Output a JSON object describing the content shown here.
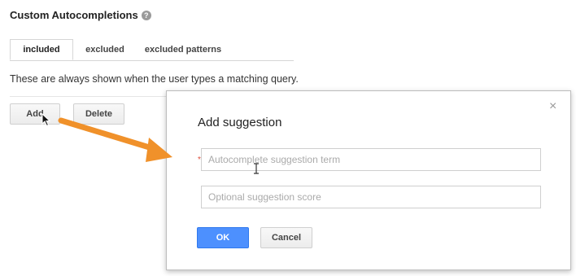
{
  "header": {
    "title": "Custom Autocompletions",
    "help_icon": "?"
  },
  "tabs": [
    {
      "label": "included",
      "active": true
    },
    {
      "label": "excluded",
      "active": false
    },
    {
      "label": "excluded patterns",
      "active": false
    }
  ],
  "description": "These are always shown when the user types a matching query.",
  "toolbar": {
    "add_label": "Add",
    "delete_label": "Delete"
  },
  "dialog": {
    "title": "Add suggestion",
    "close_icon": "×",
    "required_mark": "*",
    "term_placeholder": "Autocomplete suggestion term",
    "score_placeholder": "Optional suggestion score",
    "ok_label": "OK",
    "cancel_label": "Cancel"
  },
  "colors": {
    "accent": "#4d90fe",
    "annotation_arrow": "#f0912a",
    "required": "#dd4b39"
  },
  "icons": [
    "help-icon",
    "close-icon",
    "mouse-pointer-icon",
    "text-cursor-icon",
    "annotation-arrow-icon"
  ]
}
